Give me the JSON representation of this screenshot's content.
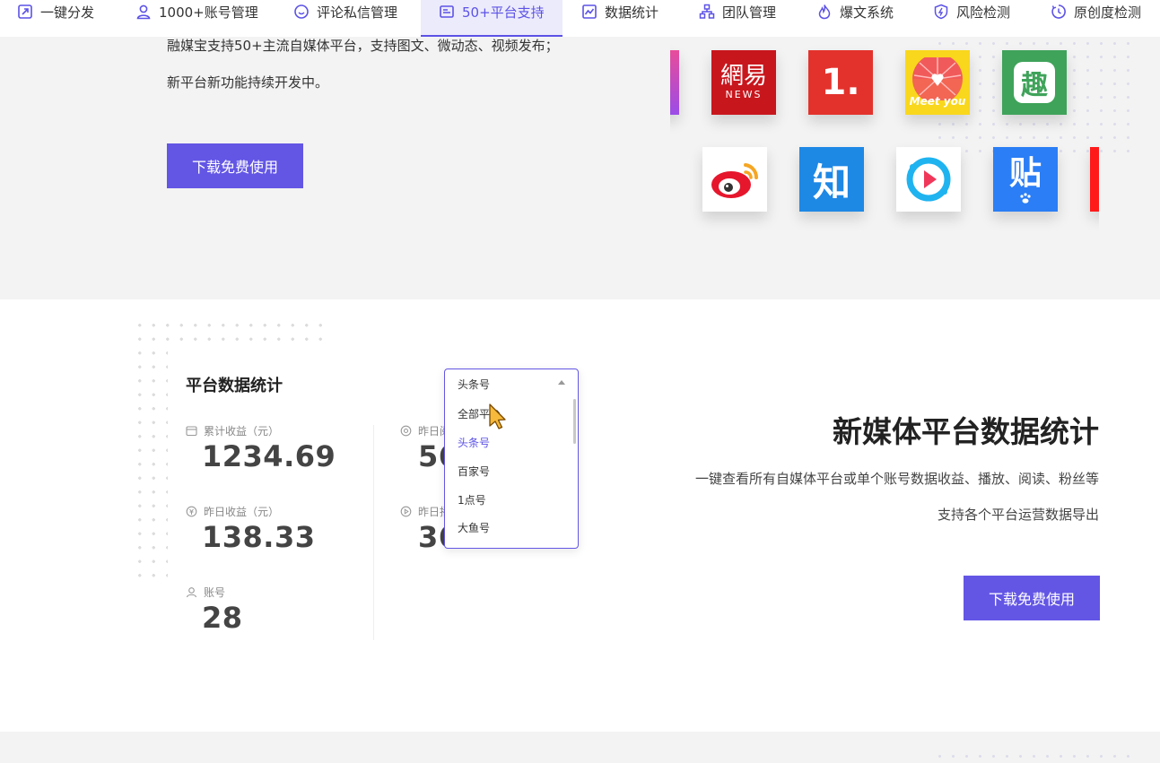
{
  "nav": {
    "items": [
      {
        "label": "一键分发",
        "icon": "share-icon"
      },
      {
        "label": "1000+账号管理",
        "icon": "user-icon"
      },
      {
        "label": "评论私信管理",
        "icon": "chat-icon"
      },
      {
        "label": "50+平台支持",
        "icon": "platform-icon",
        "active": true
      },
      {
        "label": "数据统计",
        "icon": "chart-icon"
      },
      {
        "label": "团队管理",
        "icon": "team-icon"
      },
      {
        "label": "爆文系统",
        "icon": "fire-icon"
      },
      {
        "label": "风险检测",
        "icon": "shield-icon"
      },
      {
        "label": "原创度检测",
        "icon": "originality-icon"
      }
    ],
    "accent": "#5c52e6"
  },
  "platform_section": {
    "line1": "融媒宝支持50+主流自媒体平台，支持图文、微动态、视频发布；",
    "line2": "新平台新功能持续开发中。",
    "cta": "下载免费使用",
    "logos": {
      "netease_top": "網易",
      "netease_bottom": "NEWS",
      "yidian": "1.",
      "meetyou": "Meet you",
      "qu": "趣",
      "zhihu": "知",
      "tieba": "贴"
    }
  },
  "stats_section": {
    "card_title": "平台数据统计",
    "stats": [
      {
        "label": "累计收益（元）",
        "value": "1234.69",
        "icon": "wallet-icon"
      },
      {
        "label": "昨日收益（元）",
        "value": "138.33",
        "icon": "coin-icon"
      },
      {
        "label": "账号",
        "value": "28",
        "icon": "account-icon"
      },
      {
        "label": "昨日阅",
        "value": "56",
        "icon": "eye-icon"
      },
      {
        "label": "昨日播",
        "value": "36",
        "icon": "play-icon"
      }
    ],
    "dropdown": {
      "selected": "头条号",
      "options": [
        "全部平台",
        "头条号",
        "百家号",
        "1点号",
        "大鱼号"
      ],
      "active_option": "头条号"
    },
    "heading": "新媒体平台数据统计",
    "desc1": "一键查看所有自媒体平台或单个账号数据收益、播放、阅读、粉丝等",
    "desc2": "支持各个平台运营数据导出",
    "cta": "下载免费使用",
    "button_color": "#6356e5"
  }
}
